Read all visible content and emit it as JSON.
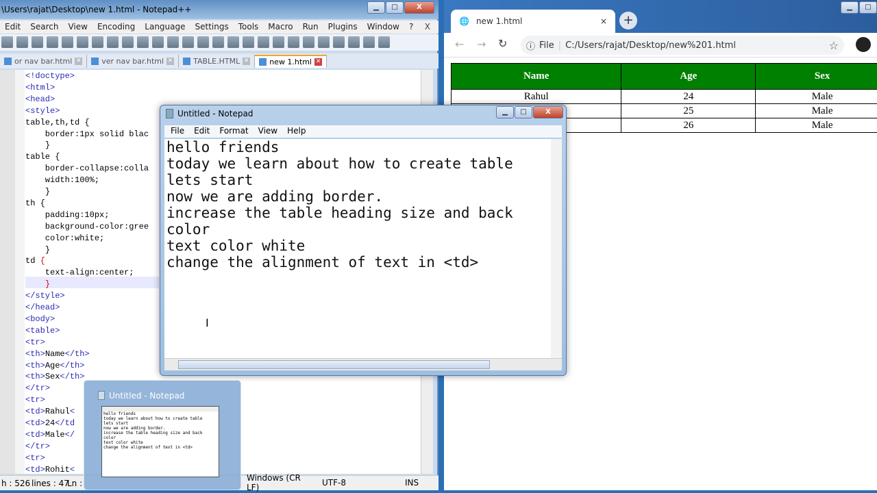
{
  "npp": {
    "title": "\\Users\\rajat\\Desktop\\new 1.html - Notepad++",
    "menu": [
      "Edit",
      "Search",
      "View",
      "Encoding",
      "Language",
      "Settings",
      "Tools",
      "Macro",
      "Run",
      "Plugins",
      "Window",
      "?"
    ],
    "menu_close": "X",
    "tabs": [
      {
        "label": "or nav bar.html",
        "active": false
      },
      {
        "label": "ver nav bar.html",
        "active": false
      },
      {
        "label": "TABLE.HTML",
        "active": false
      },
      {
        "label": "new 1.html",
        "active": true
      }
    ],
    "code": [
      "<!doctype>",
      "<html>",
      "<head>",
      "<style>",
      "table,th,td {",
      "    border:1px solid blac",
      "    }",
      "table {",
      "    border-collapse:colla",
      "    width:100%;",
      "    }",
      "th {",
      "    padding:10px;",
      "    background-color:gree",
      "    color:white;",
      "    }",
      "td {",
      "    text-align:center;",
      "    }",
      "</style>",
      "</head>",
      "<body>",
      "<table>",
      "<tr>",
      "<th>Name</th>",
      "<th>Age</th>",
      "<th>Sex</th>",
      "</tr>",
      "<tr>",
      "<td>Rahul<",
      "<td>24</td",
      "<td>Male</",
      "</tr>",
      "<tr>",
      "<td>Rohit<"
    ],
    "status": {
      "length": "h : 526",
      "lines": "lines : 47",
      "ln": "Ln :",
      "eol": "Windows (CR LF)",
      "encoding": "UTF-8",
      "mode": "INS"
    }
  },
  "chrome": {
    "tab_title": "new 1.html",
    "tab_close": "×",
    "new_tab": "+",
    "scheme_label": "File",
    "url": "C:/Users/rajat/Desktop/new%201.html",
    "table": {
      "headers": [
        "Name",
        "Age",
        "Sex"
      ],
      "rows": [
        [
          "Rahul",
          "24",
          "Male"
        ],
        [
          "",
          "25",
          "Male"
        ],
        [
          "",
          "26",
          "Male"
        ]
      ]
    },
    "header_bg": "#008000"
  },
  "notepad": {
    "title": "Untitled - Notepad",
    "menu": [
      "File",
      "Edit",
      "Format",
      "View",
      "Help"
    ],
    "lines": [
      "hello friends",
      "today we learn about how to create table",
      "lets start",
      "now we are adding border.",
      "increase the table heading size and back",
      "color",
      "text color white",
      "change the alignment of text in <td>"
    ]
  },
  "taskbar_preview": {
    "title": "Untitled - Notepad"
  }
}
